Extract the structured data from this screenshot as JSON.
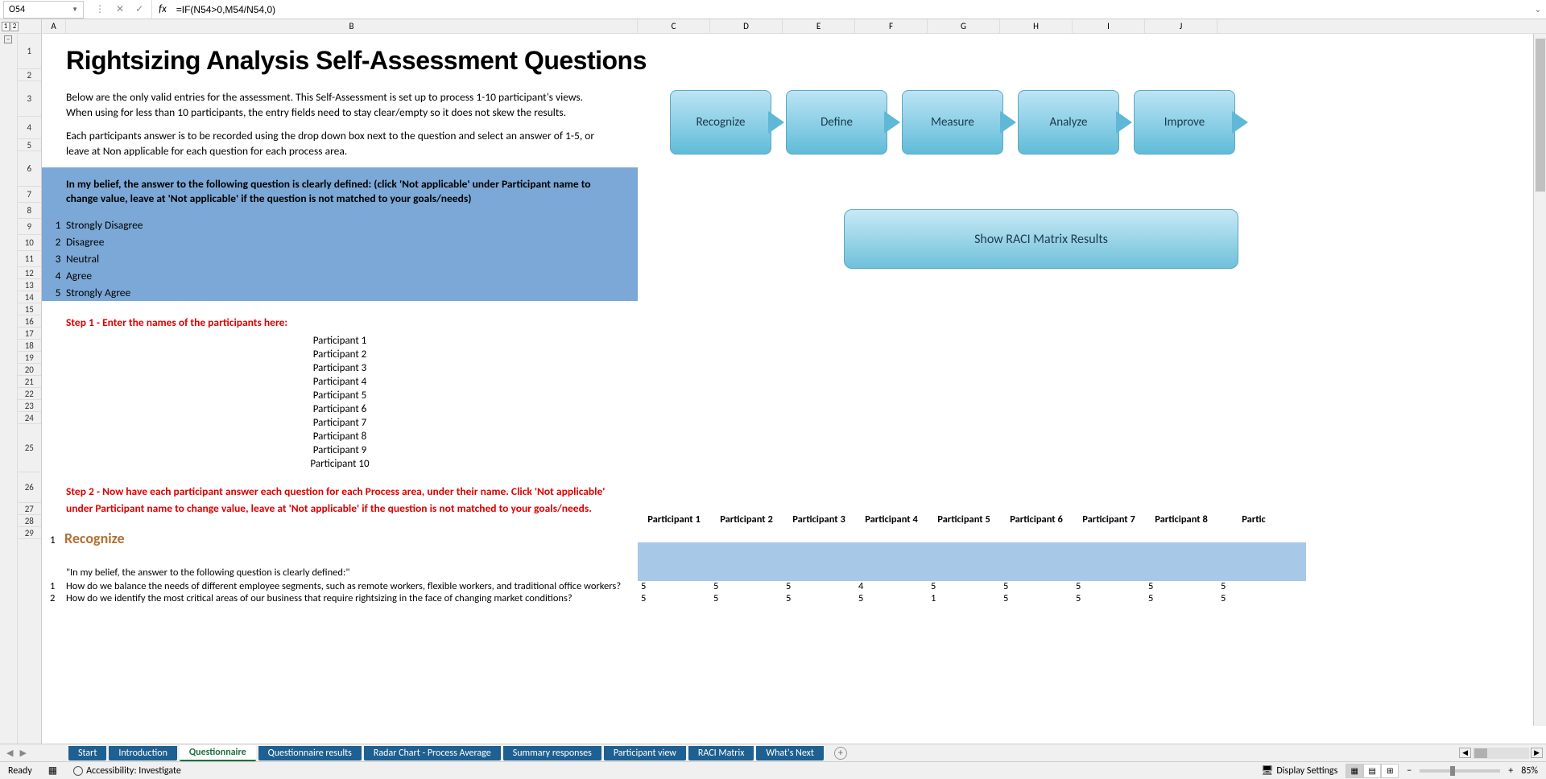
{
  "nameBox": "O54",
  "formula": "=IF(N54>0,M54/N54,0)",
  "outlineButtons": [
    "1",
    "2"
  ],
  "columns": [
    "A",
    "B",
    "C",
    "D",
    "E",
    "F",
    "G",
    "H",
    "I",
    "J"
  ],
  "rowNumbers": [
    "1",
    "2",
    "3",
    "4",
    "5",
    "6",
    "7",
    "8",
    "9",
    "10",
    "11",
    "12",
    "13",
    "14",
    "15",
    "16",
    "17",
    "18",
    "19",
    "20",
    "21",
    "22",
    "23",
    "24",
    "25",
    "26",
    "27",
    "28",
    "29"
  ],
  "title": "Rightsizing Analysis Self-Assessment Questions",
  "desc1": "Below are the only valid entries for the assessment. This Self-Assessment is set up to process 1-10 participant's views. When using for less than 10 participants, the entry fields need to stay clear/empty so it does not skew the results.",
  "desc2": "Each participants answer is to be recorded using the drop down box next to the question and select an answer of 1-5, or leave at Non applicable for each question for each process area.",
  "scaleHeader": "In my belief, the answer to the following question is clearly defined: (click 'Not applicable' under Participant name to change value, leave at 'Not applicable' if the question is not matched to your goals/needs)",
  "scale": [
    {
      "n": "1",
      "t": "Strongly Disagree"
    },
    {
      "n": "2",
      "t": "Disagree"
    },
    {
      "n": "3",
      "t": "Neutral"
    },
    {
      "n": "4",
      "t": "Agree"
    },
    {
      "n": "5",
      "t": "Strongly Agree"
    }
  ],
  "step1": "Step 1 - Enter the names of the participants here:",
  "participants": [
    "Participant 1",
    "Participant 2",
    "Participant 3",
    "Participant 4",
    "Participant 5",
    "Participant 6",
    "Participant 7",
    "Participant 8",
    "Participant 9",
    "Participant 10"
  ],
  "step2": "Step 2 - Now have each participant answer each question for each Process area, under their name. Click 'Not applicable' under Participant name to change value, leave at 'Not applicable' if the question is not matched to your goals/needs.",
  "sectionNum": "1",
  "sectionTitle": "Recognize",
  "partHeaders": [
    "Participant 1",
    "Participant 2",
    "Participant 3",
    "Participant 4",
    "Participant 5",
    "Participant 6",
    "Participant 7",
    "Participant 8",
    "Partic"
  ],
  "beliefLine": "\"In my belief, the answer to the following question is clearly defined:\"",
  "questions": [
    {
      "n": "1",
      "t": "How do we balance the needs of different employee segments, such as remote workers, flexible workers, and traditional office workers?",
      "v": [
        "5",
        "5",
        "5",
        "4",
        "5",
        "5",
        "5",
        "5",
        "5"
      ]
    },
    {
      "n": "2",
      "t": "How do we identify the most critical areas of our business that require rightsizing in the face of changing market conditions?",
      "v": [
        "5",
        "5",
        "5",
        "5",
        "1",
        "5",
        "5",
        "5",
        "5"
      ]
    }
  ],
  "processSteps": [
    "Recognize",
    "Define",
    "Measure",
    "Analyze",
    "Improve"
  ],
  "raciButton": "Show RACI Matrix Results",
  "sheetTabs": [
    {
      "label": "Start",
      "active": false
    },
    {
      "label": "Introduction",
      "active": false
    },
    {
      "label": "Questionnaire",
      "active": true
    },
    {
      "label": "Questionnaire results",
      "active": false
    },
    {
      "label": "Radar Chart - Process Average",
      "active": false
    },
    {
      "label": "Summary responses",
      "active": false
    },
    {
      "label": "Participant view",
      "active": false
    },
    {
      "label": "RACI Matrix",
      "active": false
    },
    {
      "label": "What's Next",
      "active": false
    }
  ],
  "status": {
    "ready": "Ready",
    "accessibility": "Accessibility: Investigate",
    "displaySettings": "Display Settings",
    "zoom": "85%"
  }
}
